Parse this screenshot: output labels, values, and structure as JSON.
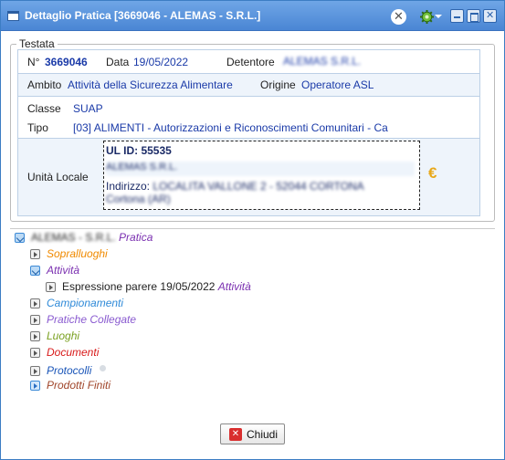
{
  "window": {
    "title": "Dettaglio Pratica [3669046 - ALEMAS - S.R.L.]",
    "icons": [
      "window-icon",
      "close-circle-icon",
      "gear-icon",
      "minimize-icon",
      "maximize-icon",
      "close-icon"
    ]
  },
  "testata": {
    "legend": "Testata",
    "n_label": "N°",
    "n_value": "3669046",
    "data_label": "Data",
    "data_value": "19/05/2022",
    "detentore_label": "Detentore",
    "detentore_value": "ALEMAS S.R.L.",
    "ambito_label": "Ambito",
    "ambito_value": "Attività della Sicurezza Alimentare",
    "origine_label": "Origine",
    "origine_value": "Operatore ASL",
    "classe_label": "Classe",
    "classe_value": "SUAP",
    "tipo_label": "Tipo",
    "tipo_value": "[03] ALIMENTI - Autorizzazioni e Riconoscimenti Comunitari - Ca",
    "unita_label": "Unità Locale",
    "ul_id": "UL ID: 55535",
    "ul_name": "ALEMAS S.R.L.",
    "ul_indirizzo_label": "Indirizzo:",
    "ul_indirizzo_value": "LOCALITA VALLONE 2 - 52044 CORTONA",
    "ul_comune": "Cortona (AR)",
    "euro_symbol": "€"
  },
  "tree": {
    "root_name": "ALEMAS - S.R.L.",
    "root_type": "Pratica",
    "items": [
      {
        "label": "Sopralluoghi",
        "color": "#f08a00"
      },
      {
        "label": "Attività",
        "color": "#7a2fb0"
      },
      {
        "label": "Campionamenti",
        "color": "#2f8ad8"
      },
      {
        "label": "Pratiche Collegate",
        "color": "#8a5bd0"
      },
      {
        "label": "Luoghi",
        "color": "#7aa020"
      },
      {
        "label": "Documenti",
        "color": "#d81a1a"
      },
      {
        "label": "Protocolli",
        "color": "#1a55b8"
      },
      {
        "label": "Prodotti Finiti",
        "color": "#a0452a"
      }
    ],
    "child_label": "Espressione parere 19/05/2022",
    "child_type": "Attività"
  },
  "footer": {
    "close_label": "Chiudi"
  }
}
